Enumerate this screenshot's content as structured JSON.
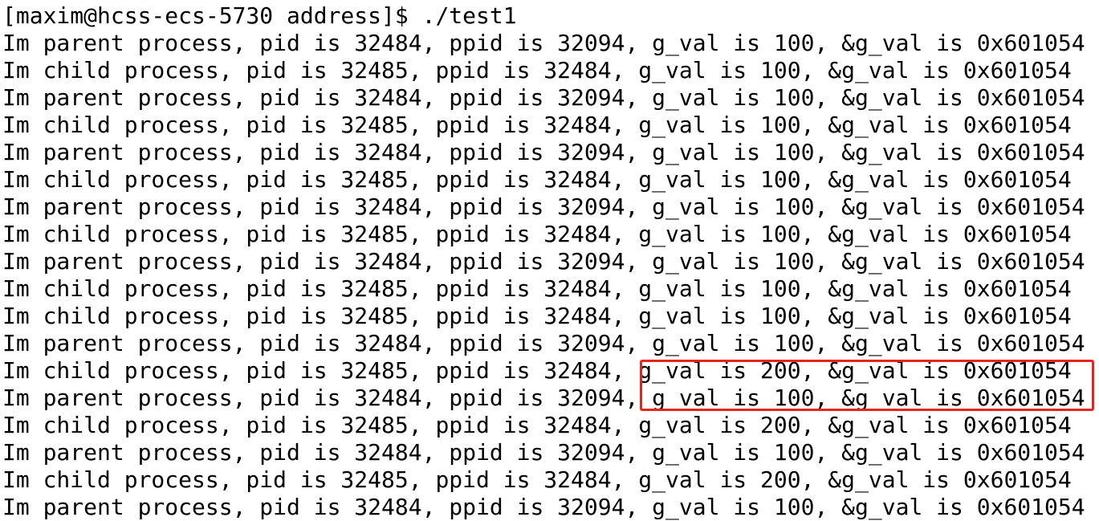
{
  "terminal": {
    "prompt": "[maxim@hcss-ecs-5730 address]$ ./test1",
    "lines": [
      "Im parent process, pid is 32484, ppid is 32094, g_val is 100, &g_val is 0x601054",
      "Im child process, pid is 32485, ppid is 32484, g_val is 100, &g_val is 0x601054",
      "Im parent process, pid is 32484, ppid is 32094, g_val is 100, &g_val is 0x601054",
      "Im child process, pid is 32485, ppid is 32484, g_val is 100, &g_val is 0x601054",
      "Im parent process, pid is 32484, ppid is 32094, g_val is 100, &g_val is 0x601054",
      "Im child process, pid is 32485, ppid is 32484, g_val is 100, &g_val is 0x601054",
      "Im parent process, pid is 32484, ppid is 32094, g_val is 100, &g_val is 0x601054",
      "Im child process, pid is 32485, ppid is 32484, g_val is 100, &g_val is 0x601054",
      "Im parent process, pid is 32484, ppid is 32094, g_val is 100, &g_val is 0x601054",
      "Im child process, pid is 32485, ppid is 32484, g_val is 100, &g_val is 0x601054",
      "Im child process, pid is 32485, ppid is 32484, g_val is 100, &g_val is 0x601054",
      "Im parent process, pid is 32484, ppid is 32094, g_val is 100, &g_val is 0x601054",
      "Im child process, pid is 32485, ppid is 32484, g_val is 200, &g_val is 0x601054",
      "Im parent process, pid is 32484, ppid is 32094, g_val is 100, &g_val is 0x601054",
      "Im child process, pid is 32485, ppid is 32484, g_val is 200, &g_val is 0x601054",
      "Im parent process, pid is 32484, ppid is 32094, g_val is 100, &g_val is 0x601054",
      "Im child process, pid is 32485, ppid is 32484, g_val is 200, &g_val is 0x601054",
      "Im parent process, pid is 32484, ppid is 32094, g_val is 100, &g_val is 0x601054"
    ]
  },
  "highlight": {
    "color": "#e8251c"
  }
}
